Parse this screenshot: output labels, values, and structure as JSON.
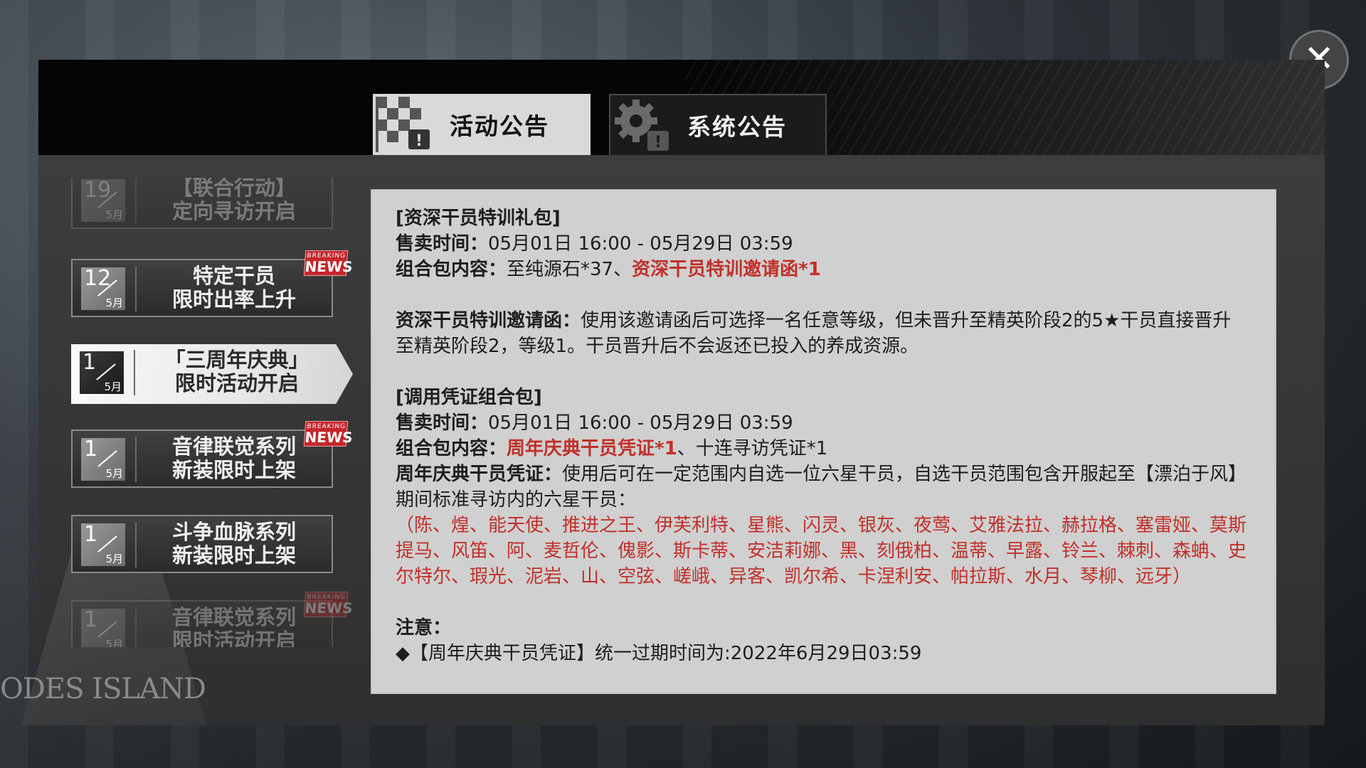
{
  "close_icon": "✕",
  "tabs": [
    {
      "label": "活动公告",
      "icon": "checkered-flag-icon",
      "active": true
    },
    {
      "label": "系统公告",
      "icon": "gear-icon",
      "active": false
    }
  ],
  "news_badge": {
    "top": "BREAKING",
    "bottom": "NEWS"
  },
  "list_items": [
    {
      "day": "19",
      "month": "5月",
      "title_line1": "【联合行动】",
      "title_line2": "定向寻访开启",
      "news": false
    },
    {
      "day": "12",
      "month": "5月",
      "title_line1": "特定干员",
      "title_line2": "限时出率上升",
      "news": true
    },
    {
      "day": "1",
      "month": "5月",
      "title_line1": "「三周年庆典」",
      "title_line2": "限时活动开启",
      "news": false,
      "selected": true
    },
    {
      "day": "1",
      "month": "5月",
      "title_line1": "音律联觉系列",
      "title_line2": "新装限时上架",
      "news": true
    },
    {
      "day": "1",
      "month": "5月",
      "title_line1": "斗争血脉系列",
      "title_line2": "新装限时上架",
      "news": false
    },
    {
      "day": "1",
      "month": "5月",
      "title_line1": "音律联觉系列",
      "title_line2": "限时活动开启",
      "news": true
    }
  ],
  "watermark": {
    "text": "ODES ISLAND"
  },
  "content": {
    "sec1_title": "[资深干员特训礼包]",
    "sec1_time_label": "售卖时间：",
    "sec1_time_value": "05月01日 16:00 - 05月29日 03:59",
    "sec1_contents_label": "组合包内容：",
    "sec1_contents_value": "至纯源石*37、",
    "sec1_contents_highlight": "资深干员特训邀请函*1",
    "sec2_label": "资深干员特训邀请函：",
    "sec2_text": "使用该邀请函后可选择一名任意等级，但未晋升至精英阶段2的5★干员直接晋升至精英阶段2，等级1。干员晋升后不会返还已投入的养成资源。",
    "sec3_title": "[调用凭证组合包]",
    "sec3_time_label": "售卖时间：",
    "sec3_time_value": "05月01日 16:00 - 05月29日 03:59",
    "sec3_contents_label": "组合包内容：",
    "sec3_contents_highlight": "周年庆典干员凭证*1",
    "sec3_contents_value": "、十连寻访凭证*1",
    "sec4_label": "周年庆典干员凭证：",
    "sec4_text": "使用后可在一定范围内自选一位六星干员，自选干员范围包含开服起至【漂泊于风】期间标准寻访内的六星干员：",
    "sec4_list": "（陈、煌、能天使、推进之王、伊芙利特、星熊、闪灵、银灰、夜莺、艾雅法拉、赫拉格、塞雷娅、莫斯提马、风笛、阿、麦哲伦、傀影、斯卡蒂、安洁莉娜、黑、刻俄柏、温蒂、早露、铃兰、棘刺、森蚺、史尔特尔、瑕光、泥岩、山、空弦、嵯峨、异客、凯尔希、卡涅利安、帕拉斯、水月、琴柳、远牙）",
    "notice_title": "注意：",
    "notice_line": "◆【周年庆典干员凭证】统一过期时间为:2022年6月29日03:59"
  }
}
